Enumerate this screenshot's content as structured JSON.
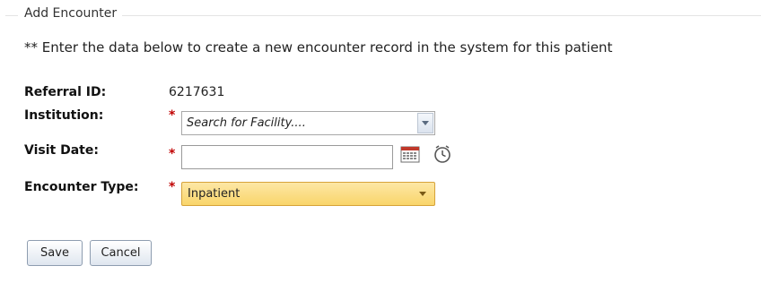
{
  "form": {
    "legend": "Add Encounter",
    "intro": "** Enter the data below to create a new encounter record in the system for this patient"
  },
  "fields": {
    "referral": {
      "label": "Referral ID:",
      "value": "6217631"
    },
    "institution": {
      "label": "Institution:",
      "required_mark": "*",
      "placeholder": "Search for Facility...."
    },
    "visit_date": {
      "label": "Visit Date:",
      "required_mark": "*",
      "value": ""
    },
    "encounter_type": {
      "label": "Encounter Type:",
      "required_mark": "*",
      "selected": "Inpatient"
    }
  },
  "buttons": {
    "save": "Save",
    "cancel": "Cancel"
  },
  "icons": {
    "calendar": "calendar-icon",
    "clock": "clock-icon"
  },
  "colors": {
    "required": "#c00000",
    "select_highlight": "#f9d56a"
  }
}
